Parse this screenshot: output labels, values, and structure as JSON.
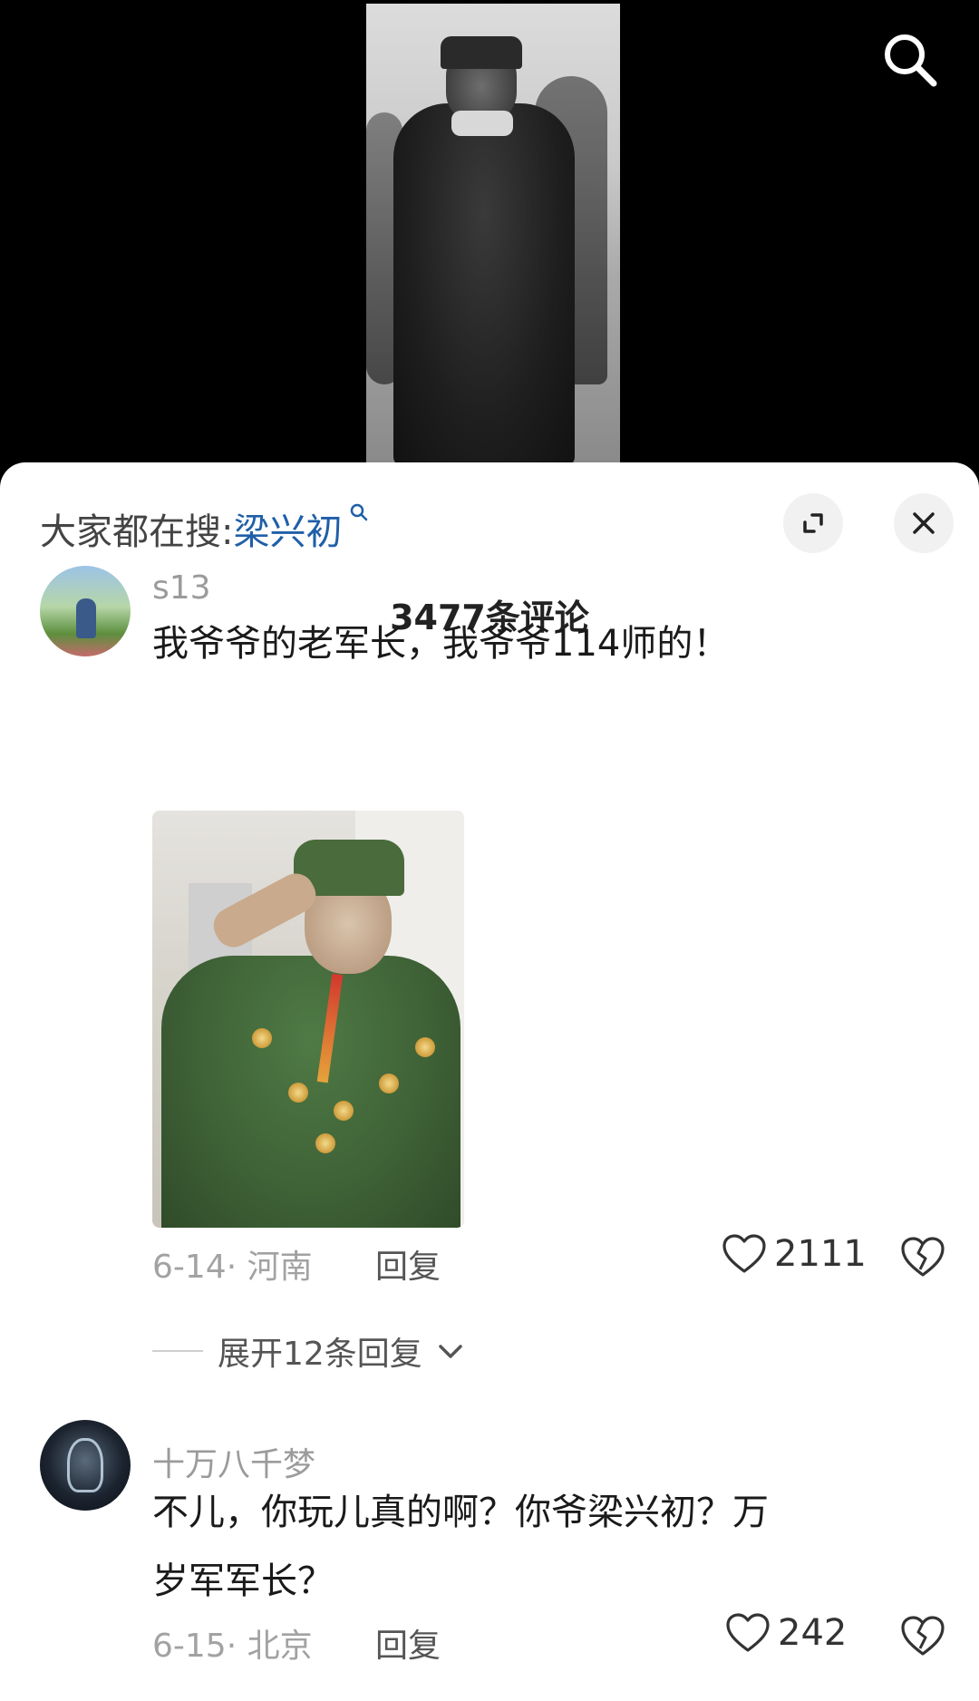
{
  "video": {
    "search_icon": "search-icon"
  },
  "sheet": {
    "hot_search_prefix": "大家都在搜:",
    "hot_search_keyword": "梁兴初",
    "comment_count": "3477条评论"
  },
  "comments": [
    {
      "username": "s13",
      "text": "我爷爷的老军长，我爷爷114师的！",
      "date": "6-14",
      "location": "河南",
      "reply_label": "回复",
      "likes": "2111",
      "has_image": true,
      "expand_replies": "展开12条回复"
    },
    {
      "username": "十万八千梦",
      "text": "不儿，你玩儿真的啊？你爷梁兴初？万岁军军长？",
      "date": "6-15",
      "location": "北京",
      "reply_label": "回复",
      "likes": "242"
    }
  ]
}
